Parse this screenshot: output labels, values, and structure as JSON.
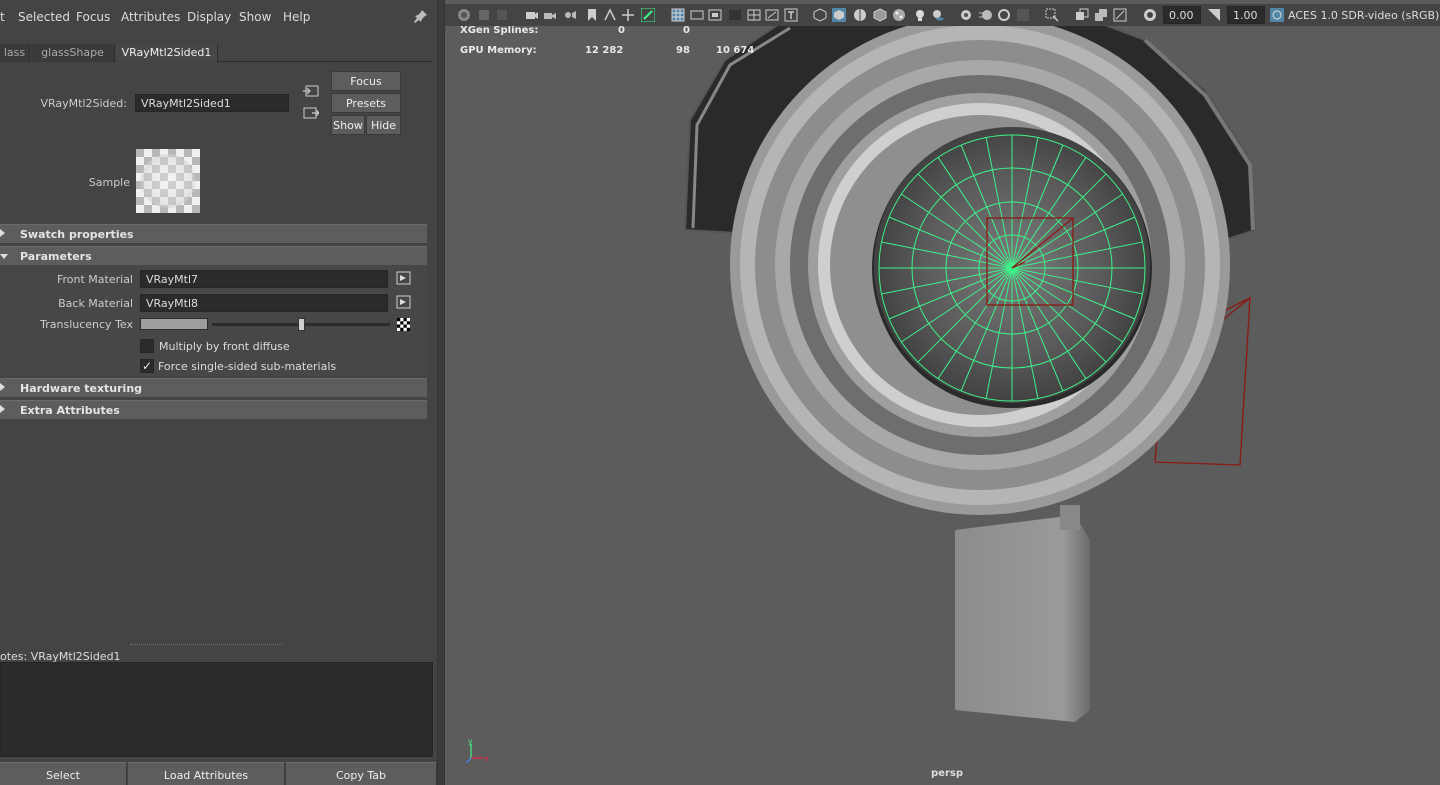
{
  "menubar": {
    "items": [
      "t",
      "Selected",
      "Focus",
      "Attributes",
      "Display",
      "Show",
      "Help"
    ]
  },
  "tabs": [
    "lass",
    "glassShape",
    "VRayMtl2Sided1"
  ],
  "node": {
    "type_label": "VRayMtl2Sided:",
    "name_value": "VRayMtl2Sided1"
  },
  "buttons": {
    "focus": "Focus",
    "presets": "Presets",
    "show": "Show",
    "hide": "Hide"
  },
  "sample_label": "Sample",
  "sections": {
    "swatch": "Swatch properties",
    "parameters": "Parameters",
    "hardware": "Hardware texturing",
    "extra": "Extra Attributes"
  },
  "parameters": {
    "front_material_label": "Front Material",
    "front_material_value": "VRayMtl7",
    "back_material_label": "Back Material",
    "back_material_value": "VRayMtl8",
    "translucency_label": "Translucency Tex",
    "translucency_level": 0.55,
    "multiply_label": "Multiply by front diffuse",
    "multiply_checked": false,
    "force_label": "Force single-sided sub-materials",
    "force_checked": true
  },
  "notes": {
    "label": "otes:  VRayMtl2Sided1"
  },
  "bottom_buttons": {
    "select": "Select",
    "load": "Load Attributes",
    "copy": "Copy Tab"
  },
  "viewport": {
    "exposure": "0.00",
    "gamma": "1.00",
    "color_management": "ACES 1.0 SDR-video (sRGB)",
    "hud": {
      "xgen_label": "XGen Splines:",
      "xgen_a": "0",
      "xgen_b": "0",
      "gpu_label": "GPU Memory:",
      "gpu_a": "12 282",
      "gpu_b": "98",
      "gpu_c": "10 674"
    },
    "camera": "persp"
  },
  "colors": {
    "accent_blue": "#5285a6",
    "wireframe_green": "#3ef28a",
    "bbox_red": "#8a1a12"
  }
}
